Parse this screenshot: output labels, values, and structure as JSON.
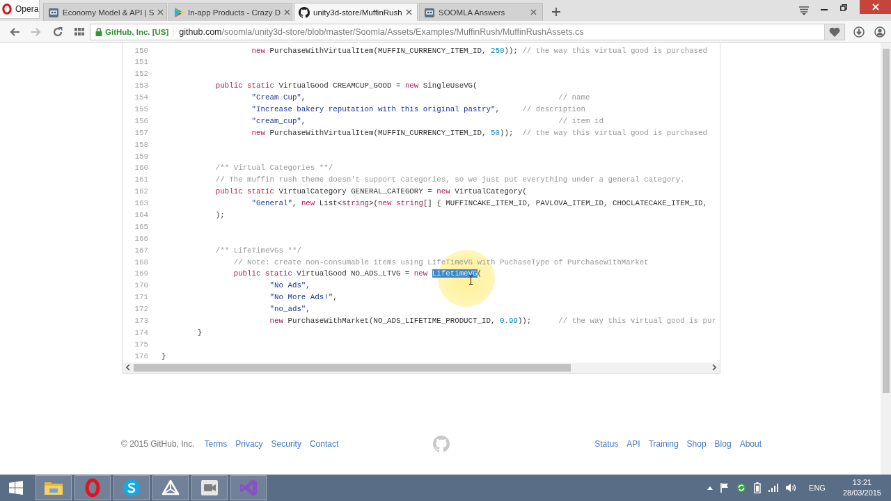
{
  "browser": {
    "brand": "Opera",
    "tabs": [
      {
        "title": "Economy Model & API | S",
        "kind": "robot",
        "selected": false
      },
      {
        "title": "In-app Products - Crazy D",
        "kind": "play",
        "selected": false
      },
      {
        "title": "unity3d-store/MuffinRush",
        "kind": "octocat",
        "selected": true
      },
      {
        "title": "SOOMLA Answers",
        "kind": "robot",
        "selected": false
      }
    ]
  },
  "toolbar": {
    "navigation": [
      {
        "kind": "back",
        "disabled": false
      },
      {
        "kind": "forward",
        "disabled": true
      },
      {
        "kind": "reload",
        "disabled": false
      },
      {
        "kind": "speed_dial",
        "disabled": false
      }
    ],
    "address_bar": {
      "security_label": "GitHub, Inc. [US]",
      "url_host": "github.com",
      "url_path": "/soomla/unity3d-store/blob/master/Soomla/Assets/Examples/MuffinRush/MuffinRushAssets.cs"
    }
  },
  "code": {
    "lines": [
      {
        "number": "150",
        "code": [
          {
            "kind": "keyword",
            "text": "                    new"
          },
          {
            "kind": "plain",
            "text": " PurchaseWithVirtualItem(MUFFIN_CURRENCY_ITEM_ID, "
          },
          {
            "kind": "number",
            "text": "250"
          },
          {
            "kind": "plain",
            "text": "));"
          },
          {
            "kind": "comment",
            "text": " // the way this virtual good is purchased"
          }
        ]
      },
      {
        "number": "151"
      },
      {
        "number": "152"
      },
      {
        "number": "153",
        "code": [
          {
            "kind": "keyword",
            "text": "            public static"
          },
          {
            "kind": "plain",
            "text": " VirtualGood CREAMCUP_GOOD = "
          },
          {
            "kind": "keyword",
            "text": "new"
          },
          {
            "kind": "plain",
            "text": " SingleUseVG("
          }
        ]
      },
      {
        "number": "154",
        "code": [
          {
            "kind": "string",
            "text": "                    \"Cream Cup\""
          },
          {
            "kind": "plain",
            "text": ","
          },
          {
            "kind": "comment",
            "text": "                                                        // name"
          }
        ]
      },
      {
        "number": "155",
        "code": [
          {
            "kind": "string",
            "text": "                    \"Increase bakery reputation with this original pastry\""
          },
          {
            "kind": "plain",
            "text": ","
          },
          {
            "kind": "comment",
            "text": "     // description"
          }
        ]
      },
      {
        "number": "156",
        "code": [
          {
            "kind": "string",
            "text": "                    \"cream_cup\""
          },
          {
            "kind": "plain",
            "text": ","
          },
          {
            "kind": "comment",
            "text": "                                                        // item id"
          }
        ]
      },
      {
        "number": "157",
        "code": [
          {
            "kind": "keyword",
            "text": "                    new"
          },
          {
            "kind": "plain",
            "text": " PurchaseWithVirtualItem(MUFFIN_CURRENCY_ITEM_ID, "
          },
          {
            "kind": "number",
            "text": "50"
          },
          {
            "kind": "plain",
            "text": "));"
          },
          {
            "kind": "comment",
            "text": "  // the way this virtual good is purchased"
          }
        ]
      },
      {
        "number": "158"
      },
      {
        "number": "159"
      },
      {
        "number": "160",
        "code": [
          {
            "kind": "comment",
            "text": "            /** Virtual Categories **/"
          }
        ]
      },
      {
        "number": "161",
        "code": [
          {
            "kind": "comment",
            "text": "            // The muffin rush theme doesn't support categories, so we just put everything under a general category."
          }
        ]
      },
      {
        "number": "162",
        "code": [
          {
            "kind": "keyword",
            "text": "            public static"
          },
          {
            "kind": "plain",
            "text": " VirtualCategory GENERAL_CATEGORY = "
          },
          {
            "kind": "keyword",
            "text": "new"
          },
          {
            "kind": "plain",
            "text": " VirtualCategory("
          }
        ]
      },
      {
        "number": "163",
        "code": [
          {
            "kind": "string",
            "text": "                    \"General\""
          },
          {
            "kind": "plain",
            "text": ", "
          },
          {
            "kind": "keyword",
            "text": "new"
          },
          {
            "kind": "plain",
            "text": " List<"
          },
          {
            "kind": "keyword",
            "text": "string"
          },
          {
            "kind": "plain",
            "text": ">("
          },
          {
            "kind": "keyword",
            "text": "new string"
          },
          {
            "kind": "plain",
            "text": "[] { MUFFINCAKE_ITEM_ID, PAVLOVA_ITEM_ID, CHOCLATECAKE_ITEM_ID,"
          }
        ]
      },
      {
        "number": "164",
        "code": [
          {
            "kind": "plain",
            "text": "            );"
          }
        ]
      },
      {
        "number": "165"
      },
      {
        "number": "166"
      },
      {
        "number": "167",
        "code": [
          {
            "kind": "comment",
            "text": "            /** LifeTimeVGs **/"
          }
        ]
      },
      {
        "number": "168",
        "code": [
          {
            "kind": "comment",
            "text": "                // Note: create non-consumable items using LifeTimeVG with PuchaseType of PurchaseWithMarket"
          }
        ]
      },
      {
        "number": "169",
        "code": [
          {
            "kind": "keyword",
            "text": "                public static"
          },
          {
            "kind": "plain",
            "text": " VirtualGood NO_ADS_LTVG = "
          },
          {
            "kind": "keyword",
            "text": "new "
          },
          {
            "kind": "selection",
            "text": "LifetimeVG"
          },
          {
            "kind": "plain",
            "text": "("
          }
        ]
      },
      {
        "number": "170",
        "code": [
          {
            "kind": "string",
            "text": "                        \"No Ads\""
          },
          {
            "kind": "plain",
            "text": ","
          }
        ]
      },
      {
        "number": "171",
        "code": [
          {
            "kind": "string",
            "text": "                        \"No More Ads!\""
          },
          {
            "kind": "plain",
            "text": ","
          }
        ]
      },
      {
        "number": "172",
        "code": [
          {
            "kind": "string",
            "text": "                        \"no_ads\""
          },
          {
            "kind": "plain",
            "text": ","
          }
        ]
      },
      {
        "number": "173",
        "code": [
          {
            "kind": "keyword",
            "text": "                        new"
          },
          {
            "kind": "plain",
            "text": " PurchaseWithMarket(NO_ADS_LIFETIME_PRODUCT_ID, "
          },
          {
            "kind": "number",
            "text": "0.99"
          },
          {
            "kind": "plain",
            "text": "));"
          },
          {
            "kind": "comment",
            "text": "      // the way this virtual good is pur"
          }
        ]
      },
      {
        "number": "174",
        "code": [
          {
            "kind": "plain",
            "text": "        }"
          }
        ]
      },
      {
        "number": "175"
      },
      {
        "number": "176",
        "code": [
          {
            "kind": "plain",
            "text": "}"
          }
        ]
      }
    ]
  },
  "footer": {
    "copyright": "© 2015 GitHub, Inc.",
    "left_links": [
      "Terms",
      "Privacy",
      "Security",
      "Contact"
    ],
    "right_links": [
      "Status",
      "API",
      "Training",
      "Shop",
      "Blog",
      "About"
    ]
  },
  "taskbar": {
    "apps": [
      {
        "kind": "folder"
      },
      {
        "kind": "ring"
      },
      {
        "kind": "s_curve"
      },
      {
        "kind": "triangle_cube"
      },
      {
        "kind": "camera"
      },
      {
        "kind": "ribbon"
      }
    ],
    "tray_icons": [
      {
        "kind": "caret"
      },
      {
        "kind": "flag"
      },
      {
        "kind": "sync"
      },
      {
        "kind": "battery"
      },
      {
        "kind": "signal"
      },
      {
        "kind": "speaker"
      }
    ],
    "language": "ENG",
    "time": "13:21",
    "date": "28/03/2015"
  }
}
